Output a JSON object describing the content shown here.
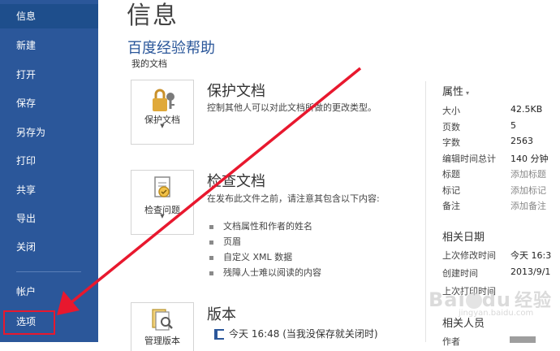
{
  "sidebar": {
    "items": [
      {
        "label": "信息"
      },
      {
        "label": "新建"
      },
      {
        "label": "打开"
      },
      {
        "label": "保存"
      },
      {
        "label": "另存为"
      },
      {
        "label": "打印"
      },
      {
        "label": "共享"
      },
      {
        "label": "导出"
      },
      {
        "label": "关闭"
      },
      {
        "label": "帐户"
      },
      {
        "label": "选项"
      }
    ]
  },
  "main": {
    "title": "信息",
    "document_name": "百度经验帮助",
    "document_location": "我的文档",
    "protect": {
      "tile_label": "保护文档",
      "title": "保护文档",
      "description": "控制其他人可以对此文档所做的更改类型。"
    },
    "inspect": {
      "tile_label": "检查问题",
      "title": "检查文档",
      "description": "在发布此文件之前，请注意其包含以下内容:",
      "bullets": [
        "文档属性和作者的姓名",
        "页眉",
        "自定义 XML 数据",
        "残障人士难以阅读的内容"
      ]
    },
    "versions": {
      "tile_label": "管理版本",
      "title": "版本",
      "item": "今天 16:48 (当我没保存就关闭时)"
    }
  },
  "properties": {
    "header": "属性",
    "rows": [
      {
        "key": "大小",
        "value": "42.5KB"
      },
      {
        "key": "页数",
        "value": "5"
      },
      {
        "key": "字数",
        "value": "2563"
      },
      {
        "key": "编辑时间总计",
        "value": "140 分钟"
      },
      {
        "key": "标题",
        "value": "添加标题"
      },
      {
        "key": "标记",
        "value": "添加标记"
      },
      {
        "key": "备注",
        "value": "添加备注"
      }
    ]
  },
  "dates": {
    "header": "相关日期",
    "rows": [
      {
        "key": "上次修改时间",
        "value": "今天 16:3"
      },
      {
        "key": "创建时间",
        "value": "2013/9/1"
      },
      {
        "key": "上次打印时间",
        "value": ""
      }
    ]
  },
  "people": {
    "header": "相关人员",
    "author_label": "作者"
  },
  "watermark": {
    "brand": "Bai",
    "brand2": "du",
    "suffix": "经验",
    "url": "jingyan.baidu.com"
  },
  "colors": {
    "sidebar_bg": "#2b579a",
    "accent_blue": "#2b579a",
    "annotation_red": "#e8182e"
  }
}
